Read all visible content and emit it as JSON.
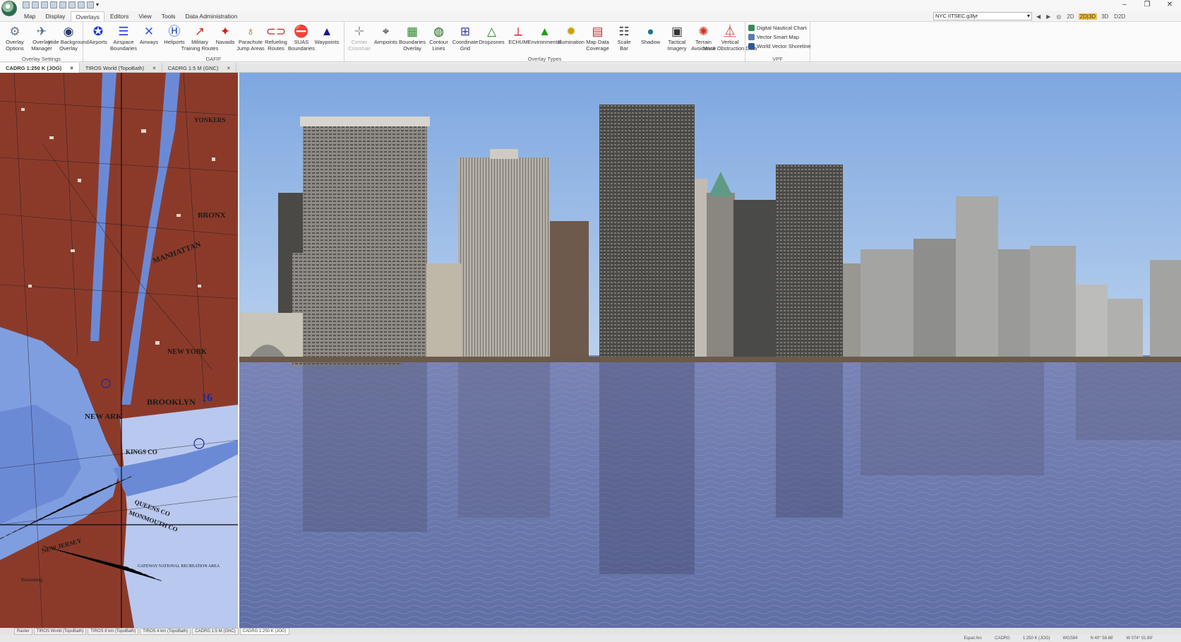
{
  "titlebar": {
    "window_controls": [
      "–",
      "❐",
      "✕"
    ]
  },
  "menu": {
    "items": [
      "Map",
      "Display",
      "Overlays",
      "Editors",
      "View",
      "Tools",
      "Data Administration"
    ],
    "active": "Overlays"
  },
  "view_selector": {
    "scene_value": "NYC IITSEC.g3lyr",
    "modes": [
      "2D",
      "2D|3D",
      "3D",
      "D2D"
    ],
    "active_mode": "2D|3D"
  },
  "ribbon": {
    "groups": [
      {
        "label": "Overlay Settings",
        "buttons": [
          {
            "label": "Overlay\nOptions",
            "icon": "gear-icon",
            "glyph": "⚙",
            "color": "#6a7a8a"
          },
          {
            "label": "Overlay\nManager",
            "icon": "layers-manager-icon",
            "glyph": "✈",
            "color": "#4a6a8a"
          },
          {
            "label": "Hide Background\nOverlay",
            "icon": "eye-icon",
            "glyph": "◉",
            "color": "#2a3a6a"
          }
        ]
      },
      {
        "label": "DAFIF",
        "buttons": [
          {
            "label": "Airports",
            "icon": "airport-icon",
            "glyph": "✪",
            "color": "#1a3ad0"
          },
          {
            "label": "Airspace\nBoundaries",
            "icon": "airspace-icon",
            "glyph": "☰",
            "color": "#1a3ad0"
          },
          {
            "label": "Airways",
            "icon": "airways-icon",
            "glyph": "✕",
            "color": "#3a5ae0"
          },
          {
            "label": "Heliports",
            "icon": "heliport-icon",
            "glyph": "Ⓗ",
            "color": "#1a3ad0"
          },
          {
            "label": "Military\nTraining Routes",
            "icon": "training-routes-icon",
            "glyph": "↗",
            "color": "#c83030"
          },
          {
            "label": "Navaids",
            "icon": "navaid-icon",
            "glyph": "✦",
            "color": "#d02020"
          },
          {
            "label": "Parachute\nJump Areas",
            "icon": "parachute-icon",
            "glyph": "♁",
            "color": "#8a5a1a"
          },
          {
            "label": "Refueling\nRoutes",
            "icon": "refueling-icon",
            "glyph": "⊂⊃",
            "color": "#d02020"
          },
          {
            "label": "SUAS\nBoundaries",
            "icon": "no-fly-icon",
            "glyph": "⛔",
            "color": "#d02020"
          },
          {
            "label": "Waypoints",
            "icon": "waypoint-icon",
            "glyph": "▲",
            "color": "#1a1a8a"
          }
        ]
      },
      {
        "label": "Overlay Types",
        "buttons": [
          {
            "label": "Center\nCrosshair",
            "icon": "crosshair-icon",
            "glyph": "✛",
            "color": "#aaaaaa",
            "disabled": true
          },
          {
            "label": "Aimpoints",
            "icon": "aimpoint-icon",
            "glyph": "⌖",
            "color": "#333333"
          },
          {
            "label": "Boundaries\nOverlay",
            "icon": "boundaries-icon",
            "glyph": "▦",
            "color": "#2a8a2a"
          },
          {
            "label": "Contour\nLines",
            "icon": "contour-icon",
            "glyph": "◍",
            "color": "#1a6a1a"
          },
          {
            "label": "Coordinate\nGrid",
            "icon": "grid-icon",
            "glyph": "⊞",
            "color": "#3a3ab0"
          },
          {
            "label": "Dropzones",
            "icon": "dropzone-icon",
            "glyph": "△",
            "color": "#1a8a1a"
          },
          {
            "label": "ECHUM",
            "icon": "echum-icon",
            "glyph": "⟂",
            "color": "#d02020"
          },
          {
            "label": "Environmental",
            "icon": "tree-icon",
            "glyph": "▲",
            "color": "#1aa01a"
          },
          {
            "label": "Illumination",
            "icon": "sun-icon",
            "glyph": "✹",
            "color": "#c8a000"
          },
          {
            "label": "Map Data\nCoverage",
            "icon": "coverage-icon",
            "glyph": "▤",
            "color": "#c03030"
          },
          {
            "label": "Scale\nBar",
            "icon": "scale-bar-icon",
            "glyph": "☷",
            "color": "#333333"
          },
          {
            "label": "Shadow",
            "icon": "globe-icon",
            "glyph": "●",
            "color": "#1a7a8a"
          },
          {
            "label": "Tactical\nImagery",
            "icon": "tactical-imagery-icon",
            "glyph": "▣",
            "color": "#333333"
          },
          {
            "label": "Terrain\nAvoidance",
            "icon": "terrain-icon",
            "glyph": "✺",
            "color": "#d03020"
          },
          {
            "label": "Vertical\nMask Obstruction Data",
            "icon": "obstruction-icon",
            "glyph": "⏅",
            "color": "#c02020"
          }
        ]
      },
      {
        "label": "VPF",
        "items": [
          {
            "label": "Digital Nautical Chart",
            "icon": "nautical-chart-icon",
            "color": "#3a8a5a"
          },
          {
            "label": "Vector Smart Map",
            "icon": "smart-map-icon",
            "color": "#5a7ab0"
          },
          {
            "label": "World Vector Shoreline",
            "icon": "shoreline-icon",
            "color": "#2a5a9a"
          }
        ]
      }
    ]
  },
  "doc_tabs": [
    {
      "label": "CADRG 1:250 K (JOG)",
      "active": true
    },
    {
      "label": "TIROS World (TopoBath)",
      "active": false
    },
    {
      "label": "CADRG 1:5 M (GNC)",
      "active": false
    }
  ],
  "map_labels": [
    "YONKERS",
    "BRONX",
    "MANHATTAN",
    "BROOKLYN",
    "NEW YORK",
    "NEW JERSEY",
    "QUEENS CO",
    "KINGS CO",
    "MONMOUTH CO",
    "GATEWAY NATIONAL RECREATION AREA",
    "Keansburg",
    "NEW ARK",
    "16"
  ],
  "bottom_tabs": [
    {
      "label": "Raster",
      "active": false
    },
    {
      "label": "TIROS World (TopoBath)",
      "active": false
    },
    {
      "label": "TIROS 8 km (TopoBath)",
      "active": false
    },
    {
      "label": "TIROS 4 km (TopoBath)",
      "active": false
    },
    {
      "label": "CADRG 1:5 M (GNC)",
      "active": false
    },
    {
      "label": "CADRG 1:250 K (JOG)",
      "active": true
    }
  ],
  "status": [
    "Equal Arc",
    "CADRG",
    "1:250 K (JOG)",
    "WGS84",
    "N  40° 58.66'",
    "W  074° 01.89'"
  ],
  "colors": {
    "map_land": "#8b3a2a",
    "map_water": "#6b8fd8",
    "sky_top": "#7ea7e0",
    "sky_bottom": "#bcd3ee",
    "water": "#6a7cb2",
    "active_mode": "#f5c04a"
  }
}
